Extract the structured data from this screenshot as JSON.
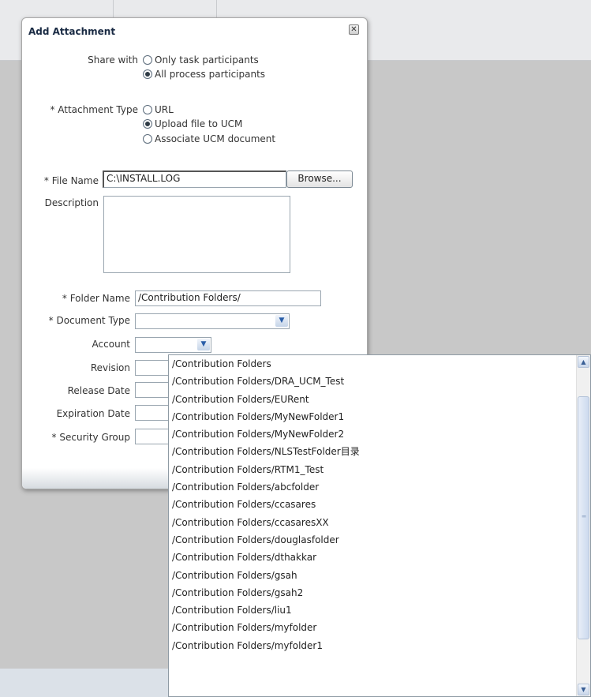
{
  "dialog": {
    "title": "Add Attachment",
    "close_icon": "close-icon",
    "share_with": {
      "label": "Share with",
      "options": [
        {
          "label": "Only task participants",
          "selected": false
        },
        {
          "label": "All process participants",
          "selected": true
        }
      ]
    },
    "attachment_type": {
      "label": "* Attachment Type",
      "options": [
        {
          "label": "URL",
          "selected": false
        },
        {
          "label": "Upload file to UCM",
          "selected": true
        },
        {
          "label": "Associate UCM document",
          "selected": false
        }
      ]
    },
    "file_name": {
      "label": "* File Name",
      "value": "C:\\INSTALL.LOG",
      "browse_label": "Browse..."
    },
    "description": {
      "label": "Description",
      "value": ""
    },
    "folder_name": {
      "label": "* Folder Name",
      "value": "/Contribution Folders/"
    },
    "document_type": {
      "label": "* Document Type",
      "value": ""
    },
    "account": {
      "label": "Account",
      "value": ""
    },
    "revision": {
      "label": "Revision",
      "value": ""
    },
    "release_date": {
      "label": "Release Date",
      "value": ""
    },
    "expiration_date": {
      "label": "Expiration Date",
      "value": ""
    },
    "security_group": {
      "label": "* Security Group",
      "value": ""
    }
  },
  "folder_suggestions": [
    "/Contribution Folders",
    "/Contribution Folders/DRA_UCM_Test",
    "/Contribution Folders/EURent",
    "/Contribution Folders/MyNewFolder1",
    "/Contribution Folders/MyNewFolder2",
    "/Contribution Folders/NLSTestFolder目录",
    "/Contribution Folders/RTM1_Test",
    "/Contribution Folders/abcfolder",
    "/Contribution Folders/ccasares",
    "/Contribution Folders/ccasaresXX",
    "/Contribution Folders/douglasfolder",
    "/Contribution Folders/dthakkar",
    "/Contribution Folders/gsah",
    "/Contribution Folders/gsah2",
    "/Contribution Folders/liu1",
    "/Contribution Folders/myfolder",
    "/Contribution Folders/myfolder1"
  ],
  "colors": {
    "background": "#c8c8c8",
    "dialog_title": "#1a2b44",
    "scroll_accent": "#3a5f95"
  }
}
